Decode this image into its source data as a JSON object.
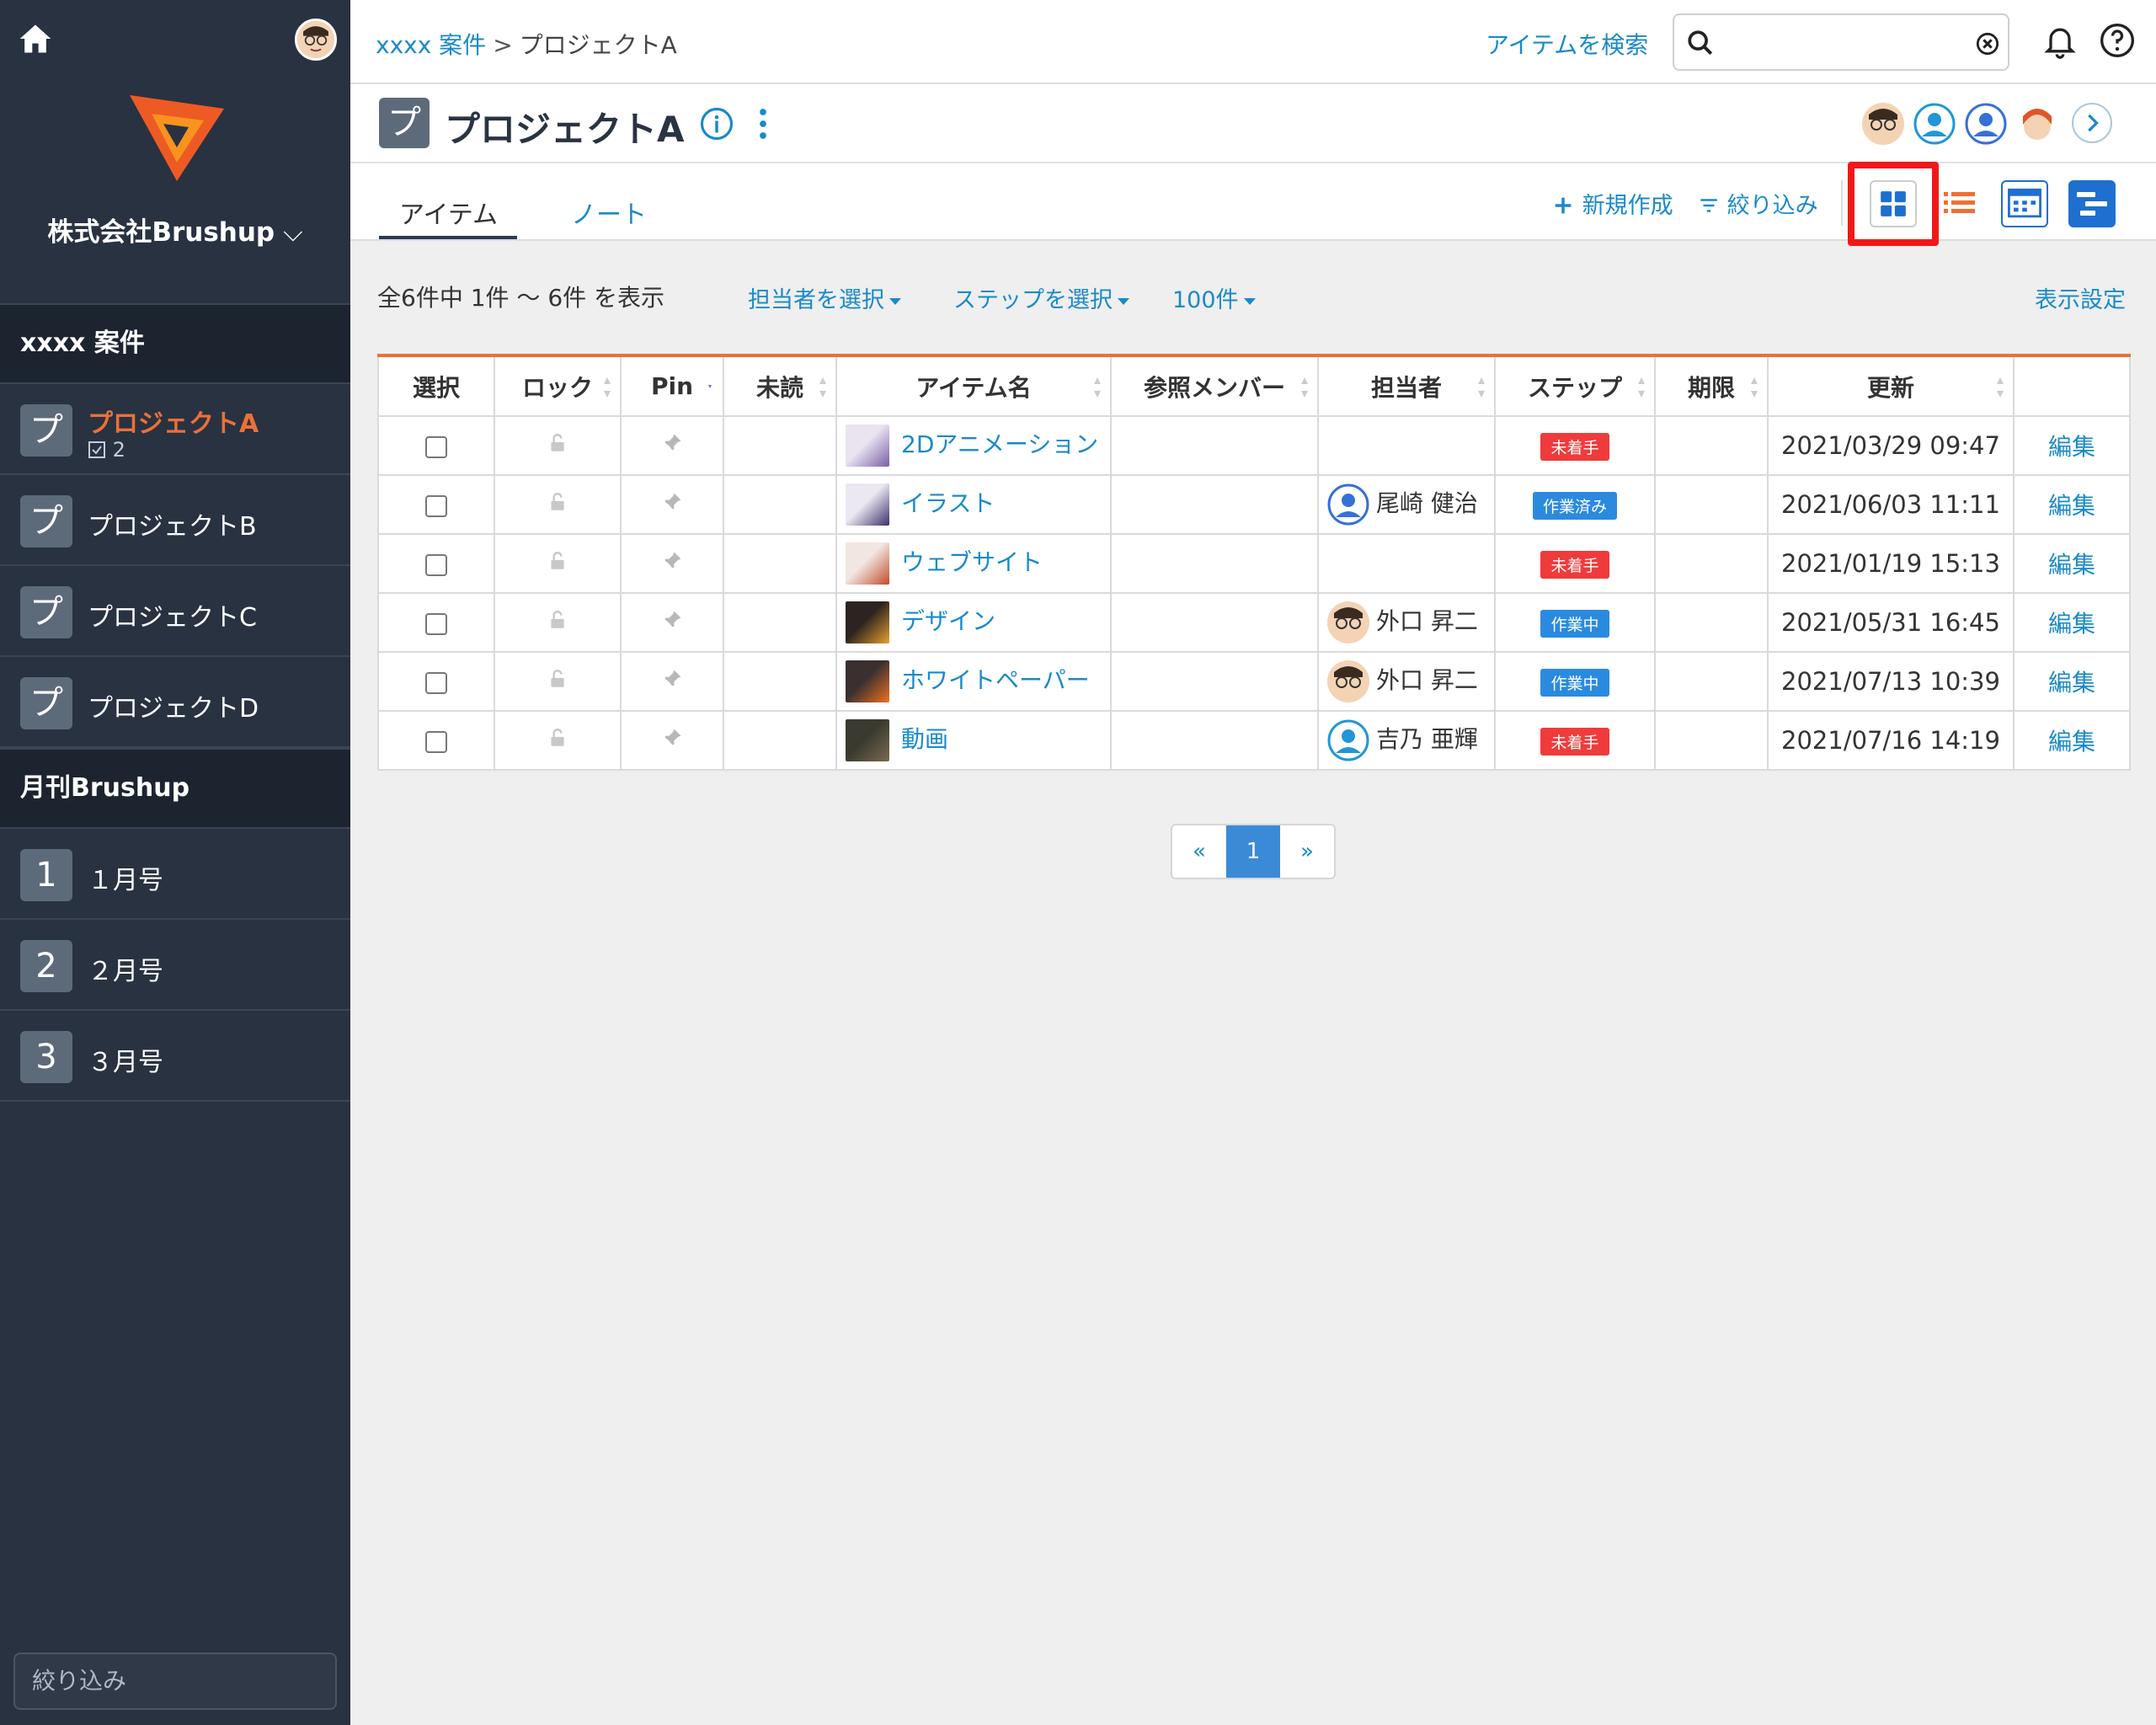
{
  "sidebar": {
    "org_name": "株式会社Brushup",
    "sections": [
      {
        "title": "xxxx 案件",
        "projects": [
          {
            "badge": "プ",
            "name": "プロジェクトA",
            "sub": "2",
            "active": true
          },
          {
            "badge": "プ",
            "name": "プロジェクトB"
          },
          {
            "badge": "プ",
            "name": "プロジェクトC"
          },
          {
            "badge": "プ",
            "name": "プロジェクトD"
          }
        ]
      },
      {
        "title": "月刊Brushup",
        "projects": [
          {
            "badge": "1",
            "name": "１月号"
          },
          {
            "badge": "2",
            "name": "２月号"
          },
          {
            "badge": "3",
            "name": "３月号"
          }
        ]
      }
    ],
    "filter_placeholder": "絞り込み"
  },
  "topbar": {
    "breadcrumb_link": "xxxx 案件",
    "breadcrumb_sep": ">",
    "breadcrumb_current": "プロジェクトA",
    "search_label": "アイテムを検索",
    "search_value": ""
  },
  "project": {
    "badge": "プ",
    "title": "プロジェクトA"
  },
  "tabs": [
    {
      "label": "アイテム"
    },
    {
      "label": "ノート"
    }
  ],
  "toolbar": {
    "new_label": "新規作成",
    "filter_label": "絞り込み"
  },
  "list": {
    "count_text": "全6件中 1件 〜 6件 を表示",
    "assignee_dropdown": "担当者を選択",
    "step_dropdown": "ステップを選択",
    "per_page_dropdown": "100件",
    "display_settings": "表示設定"
  },
  "table": {
    "headers": [
      "選択",
      "ロック",
      "Pin",
      "未読",
      "アイテム名",
      "参照メンバー",
      "担当者",
      "ステップ",
      "期限",
      "更新",
      ""
    ],
    "rows": [
      {
        "name": "2Dアニメーション",
        "assignee": "",
        "step": "未着手",
        "step_type": "todo",
        "updated": "2021/03/29 09:47",
        "edit": "編集"
      },
      {
        "name": "イラスト",
        "assignee": "尾崎 健治",
        "step": "作業済み",
        "step_type": "prog",
        "updated": "2021/06/03 11:11",
        "edit": "編集"
      },
      {
        "name": "ウェブサイト",
        "assignee": "",
        "step": "未着手",
        "step_type": "todo",
        "updated": "2021/01/19 15:13",
        "edit": "編集"
      },
      {
        "name": "デザイン",
        "assignee": "外口 昇二",
        "step": "作業中",
        "step_type": "prog",
        "updated": "2021/05/31 16:45",
        "edit": "編集"
      },
      {
        "name": "ホワイトペーパー",
        "assignee": "外口 昇二",
        "step": "作業中",
        "step_type": "prog",
        "updated": "2021/07/13 10:39",
        "edit": "編集"
      },
      {
        "name": "動画",
        "assignee": "吉乃 亜輝",
        "step": "未着手",
        "step_type": "todo",
        "updated": "2021/07/16 14:19",
        "edit": "編集"
      }
    ]
  },
  "pager": {
    "prev": "«",
    "current": "1",
    "next": "»"
  },
  "colors": {
    "accent": "#ee6f36",
    "link": "#1a8ac8",
    "sidebar_bg": "#283241",
    "step_todo": "#ef3b3b",
    "step_progress": "#2a8ae0",
    "highlight": "#f01818"
  }
}
